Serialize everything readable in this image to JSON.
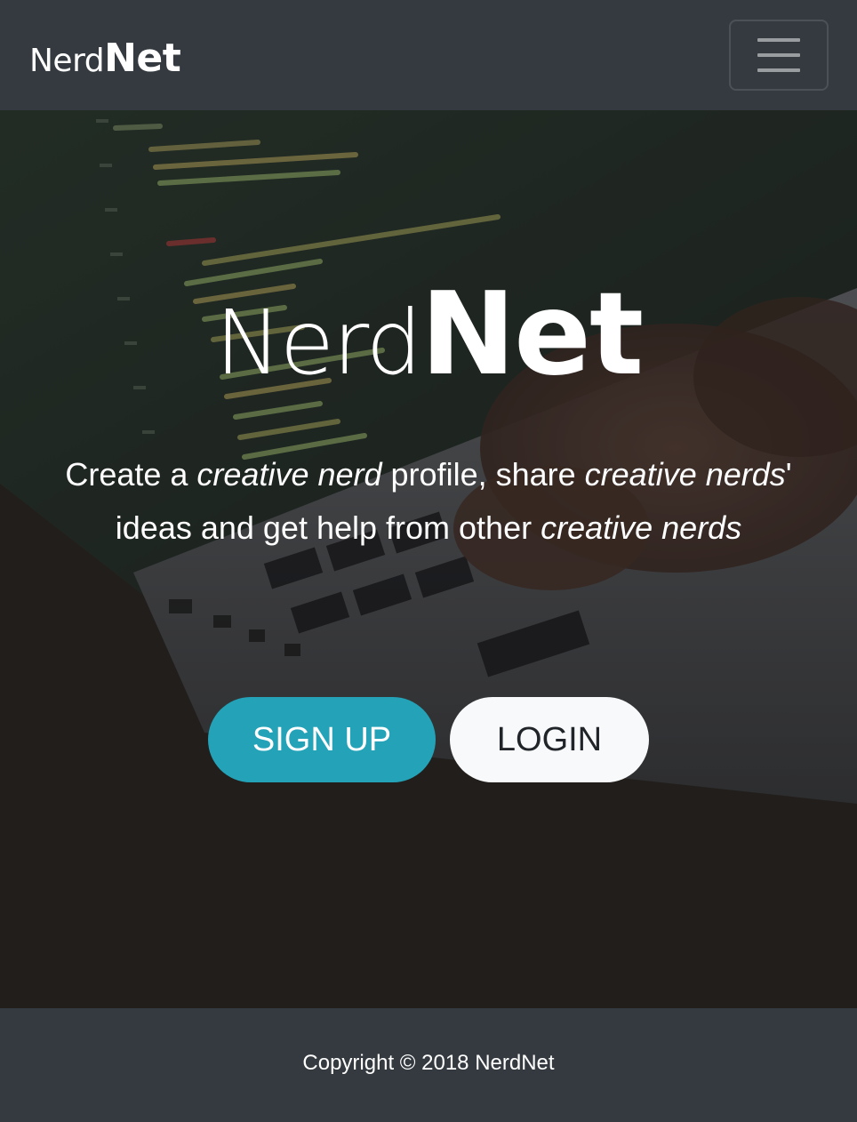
{
  "navbar": {
    "brand_light": "Nerd",
    "brand_bold": "Net",
    "menu_icon": "hamburger-menu-icon"
  },
  "hero": {
    "title_light": "Nerd",
    "title_bold": "Net",
    "tagline": {
      "p1": "Create a ",
      "p2": "creative nerd",
      "p3": " profile, share ",
      "p4": "creative nerds",
      "p5": "' ideas and get help from other ",
      "p6": "creative nerds"
    },
    "background_image": "laptop-code-photo",
    "signup_label": "SIGN UP",
    "login_label": "LOGIN"
  },
  "footer": {
    "copyright": "Copyright © 2018 NerdNet"
  },
  "colors": {
    "navbar_bg": "#343a40",
    "signup_bg": "#23a2b8",
    "login_bg": "#f8f9fa",
    "text": "#ffffff"
  }
}
